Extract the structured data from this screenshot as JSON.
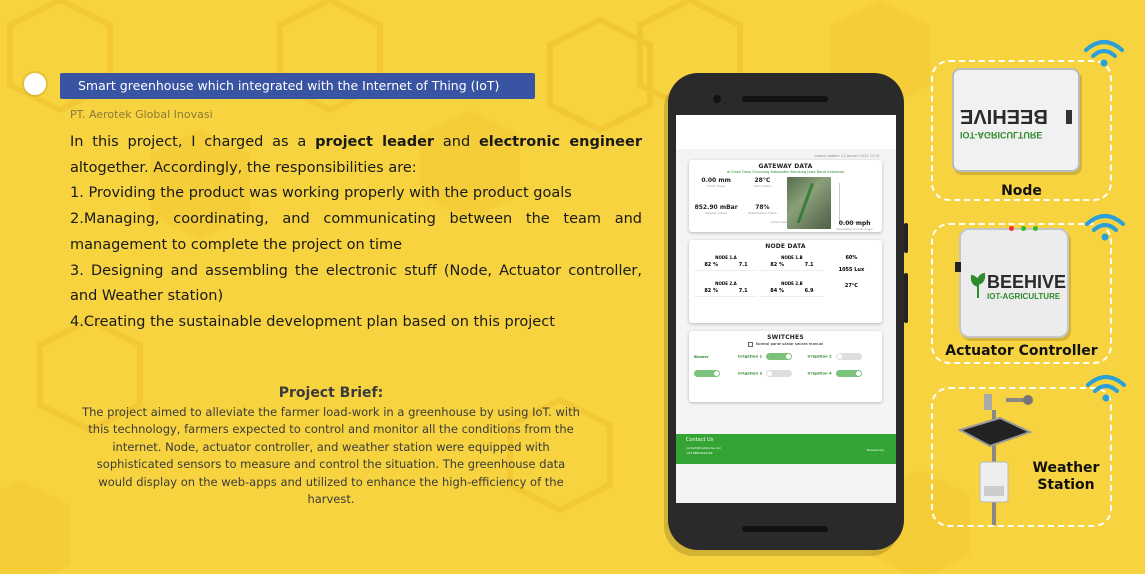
{
  "slide": {
    "title": "Smart greenhouse which integrated with the Internet of Thing (IoT)",
    "company": "PT. Aerotek Global Inovasi",
    "intro_1": "In this project, I charged as a ",
    "role_1": "project leader",
    "intro_2": " and ",
    "role_2": "electronic engineer",
    "intro_3": " altogether. Accordingly, the responsibilities are:",
    "resp_1": "1. Providing the product was working properly with the product goals",
    "resp_2": "2.Managing, coordinating, and communicating between the team and management to complete the project on time",
    "resp_3": "3. Designing and assembling the electronic stuff (Node, Actuator controller, and Weather station)",
    "resp_4": "4.Creating the sustainable development plan based on this project",
    "brief_title": "Project Brief:",
    "brief_text": "The project aimed to alleviate the farmer load-work in a greenhouse by using IoT. with this technology, farmers expected to control and monitor all the conditions from the internet. Node, actuator controller, and weather station were equipped with sophisticated sensors to measure and control the situation. The greenhouse data would display on the web-apps and utilized to enhance the high-efficiency of the harvest."
  },
  "app": {
    "updated": "Latest update: 21 Januari 2021 13:31",
    "gateway_title": "GATEWAY DATA",
    "gateway_sub": "di Gisah Desa Ciluncang Kabupaten Bandung Jawa Barat Indonesia",
    "gw_rain": "0.00 mm",
    "gw_rain_label": "Curah Hujan",
    "gw_temp": "28°C",
    "gw_temp_label": "Suhu Udara",
    "gw_press": "852.90 mBar",
    "gw_press_label": "Tekanan Udara",
    "gw_hum": "78%",
    "gw_hum_label": "Kelembaban Udara",
    "gw_ins_label": "Lokasi Gateway",
    "gw_wind": "0.00 mph",
    "gw_wind_label": "Kecepatan & Arah Angin",
    "node_title": "NODE DATA",
    "n1a": "NODE 1.A",
    "n1a_h": "82 %",
    "n1a_p": "7.1",
    "n1b": "NODE 1.B",
    "n1b_h": "82 %",
    "n1b_p": "7.1",
    "n2a": "NODE 2.A",
    "n2a_h": "82 %",
    "n2a_p": "7.1",
    "n2b": "NODE 2.B",
    "n2b_h": "84 %",
    "n2b_p": "6.9",
    "nr_hum": "60%",
    "nr_lux": "1055 Lux",
    "nr_temp": "27°C",
    "switch_title": "SWITCHES",
    "switch_cb": "Kontrol panel saklar secara manual",
    "blower": "Blower",
    "irr1": "Irrigation 1",
    "irr2": "Irrigation 2",
    "irr3": "Irrigation 3",
    "irr4": "Irrigation 4",
    "on": "ON",
    "off": "OFF",
    "contact_title": "Contact Us",
    "contact_mail": "contact@foodmama.com",
    "contact_phone": "+62 88824441199",
    "powered": "Powered by"
  },
  "devices": {
    "node_label": "Node",
    "actuator_label": "Actuator Controller",
    "weather_label_1": "Weather",
    "weather_label_2": "Station",
    "brand": "BEEHIVE",
    "brand_sub": "IOT-AGRICULTURE"
  },
  "colors": {
    "background": "#f7d33f",
    "title_bar": "#3a54a4",
    "wifi": "#2b9fd8",
    "app_green": "#34a534"
  }
}
